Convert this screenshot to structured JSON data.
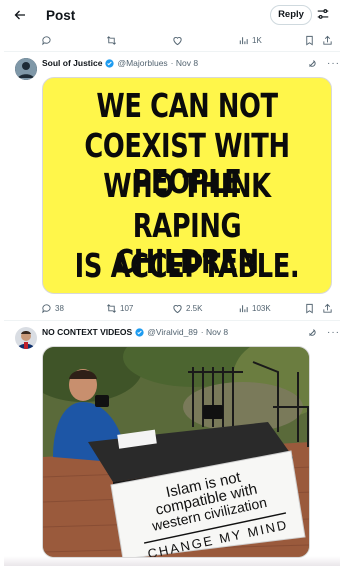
{
  "header": {
    "title": "Post",
    "reply_label": "Reply"
  },
  "top_actions": {
    "views": "1K"
  },
  "tweet1": {
    "name": "Soul of Justice",
    "handle": "@Majorblues",
    "date": "· Nov 8",
    "meme_lines": [
      "WE CAN NOT",
      "COEXIST WITH PEOPLE",
      "WHO THINK",
      "RAPING CHILDREN",
      "IS ACCEPTABLE."
    ],
    "meme_bg": "#fff64a",
    "replies": "38",
    "reposts": "107",
    "likes": "2.5K",
    "views": "103K"
  },
  "tweet2": {
    "name": "NO CONTEXT VIDEOS",
    "handle": "@Viralvid_89",
    "date": "· Nov 8",
    "sign_lines": [
      "Islam is not",
      "compatible with",
      "western civilization"
    ],
    "sign_footer": "CHANGE MY MIND"
  },
  "colors": {
    "verified": "#1d9bf0",
    "muted": "#536471",
    "text": "#0f1419"
  }
}
